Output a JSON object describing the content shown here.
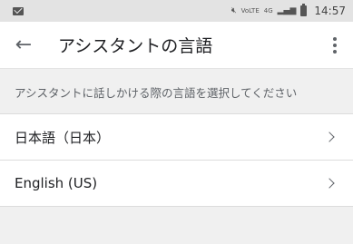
{
  "status_bar": {
    "icons": [
      "mail-icon",
      "mute-icon",
      "volte-icon",
      "4g-icon",
      "signal-icon",
      "battery-icon"
    ],
    "volte_label": "VoLTE",
    "network_label": "4G",
    "time": "14:57"
  },
  "app_bar": {
    "back_icon": "arrow-left-icon",
    "title": "アシスタントの言語",
    "more_icon": "more-vert-icon"
  },
  "description": "アシスタントに話しかける際の言語を選択してください",
  "languages": [
    {
      "label": "日本語（日本）",
      "icon": "chevron-right-icon"
    },
    {
      "label": "English (US)",
      "icon": "chevron-right-icon"
    }
  ]
}
